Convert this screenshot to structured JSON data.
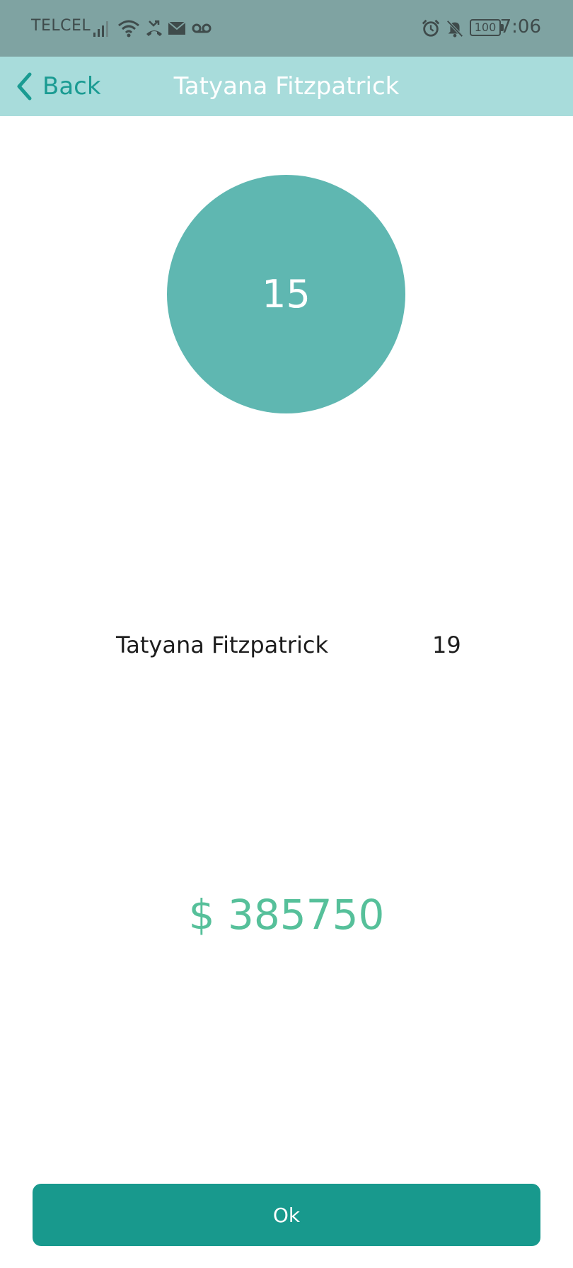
{
  "status_bar": {
    "carrier": "TELCEL",
    "time": "7:06",
    "battery": "100",
    "icons": [
      "signal-icon",
      "wifi-icon",
      "missed-call-icon",
      "mail-icon",
      "voicemail-icon",
      "alarm-icon",
      "mute-icon",
      "battery-icon"
    ]
  },
  "nav": {
    "back_label": "Back",
    "title": "Tatyana Fitzpatrick"
  },
  "circle": {
    "value": "15"
  },
  "row": {
    "name": "Tatyana Fitzpatrick",
    "value": "19"
  },
  "amount": "$ 385750",
  "ok_label": "Ok",
  "colors": {
    "status_bar": "#7fa3a2",
    "nav_bar": "#a8dcdb",
    "accent": "#1a9b92",
    "circle": "#5fb7b1",
    "amount": "#56c09a",
    "button": "#18998d"
  }
}
